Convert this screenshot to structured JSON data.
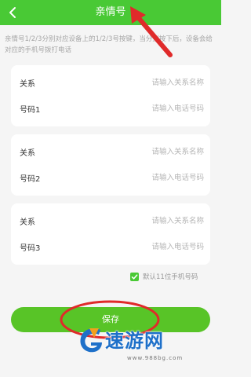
{
  "header": {
    "title": "亲情号",
    "back_icon": "chevron-left-icon",
    "background": "#49c935"
  },
  "description": "亲情号1/2/3分别对应设备上的1/2/3号按键，当分别按下后，设备会给对应的手机号拨打电话",
  "cards": [
    {
      "relation": {
        "label": "关系",
        "placeholder": "请输入关系名称",
        "value": ""
      },
      "phone": {
        "label": "号码1",
        "placeholder": "请输入电话号码",
        "value": ""
      }
    },
    {
      "relation": {
        "label": "关系",
        "placeholder": "请输入关系名称",
        "value": ""
      },
      "phone": {
        "label": "号码2",
        "placeholder": "请输入电话号码",
        "value": ""
      }
    },
    {
      "relation": {
        "label": "关系",
        "placeholder": "请输入关系名称",
        "value": ""
      },
      "phone": {
        "label": "号码3",
        "placeholder": "请输入电话号码",
        "value": ""
      }
    }
  ],
  "default_checkbox": {
    "label": "默认11位手机号码",
    "checked": true
  },
  "save_button": {
    "label": "保存",
    "color": "#58c427"
  },
  "annotation": {
    "color": "#e02a2a"
  },
  "watermark": {
    "text": "速游网",
    "url": "www.988bg.com",
    "color": "#1e70c9"
  }
}
